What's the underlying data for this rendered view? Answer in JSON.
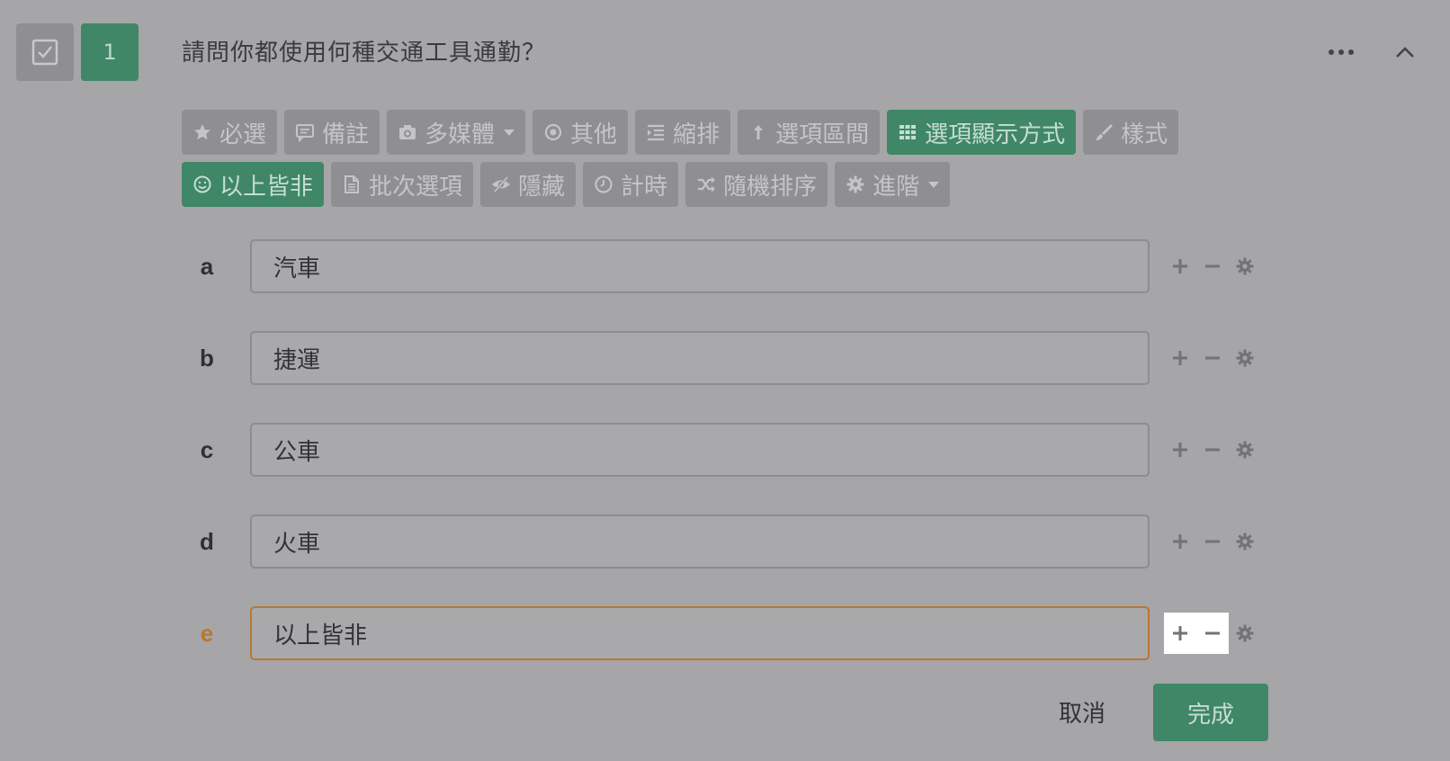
{
  "question": {
    "number": "1",
    "title": "請問你都使用何種交通工具通勤？"
  },
  "toolbar": {
    "row1": [
      {
        "label": "必選",
        "icon": "star-icon",
        "active": false
      },
      {
        "label": "備註",
        "icon": "comment-icon",
        "active": false
      },
      {
        "label": "多媒體",
        "icon": "camera-icon",
        "active": false,
        "dropdown": true
      },
      {
        "label": "其他",
        "icon": "radio-dot-icon",
        "active": false
      },
      {
        "label": "縮排",
        "icon": "indent-icon",
        "active": false
      },
      {
        "label": "選項區間",
        "icon": "arrow-up-icon",
        "active": false
      },
      {
        "label": "選項顯示方式",
        "icon": "grid-icon",
        "active": true
      },
      {
        "label": "樣式",
        "icon": "brush-icon",
        "active": false
      }
    ],
    "row2": [
      {
        "label": "以上皆非",
        "icon": "smile-icon",
        "active": true
      },
      {
        "label": "批次選項",
        "icon": "document-icon",
        "active": false
      },
      {
        "label": "隱藏",
        "icon": "eye-slash-icon",
        "active": false
      },
      {
        "label": "計時",
        "icon": "clock-icon",
        "active": false
      },
      {
        "label": "隨機排序",
        "icon": "shuffle-icon",
        "active": false
      },
      {
        "label": "進階",
        "icon": "gear-icon",
        "active": false,
        "dropdown": true
      }
    ]
  },
  "options": [
    {
      "letter": "a",
      "value": "汽車"
    },
    {
      "letter": "b",
      "value": "捷運"
    },
    {
      "letter": "c",
      "value": "公車"
    },
    {
      "letter": "d",
      "value": "火車"
    },
    {
      "letter": "e",
      "value": "以上皆非",
      "focused": true
    }
  ],
  "footer": {
    "cancel_label": "取消",
    "done_label": "完成"
  },
  "colors": {
    "accent": "#3f8767",
    "focus": "#b87732",
    "background": "#a6a5a8"
  }
}
